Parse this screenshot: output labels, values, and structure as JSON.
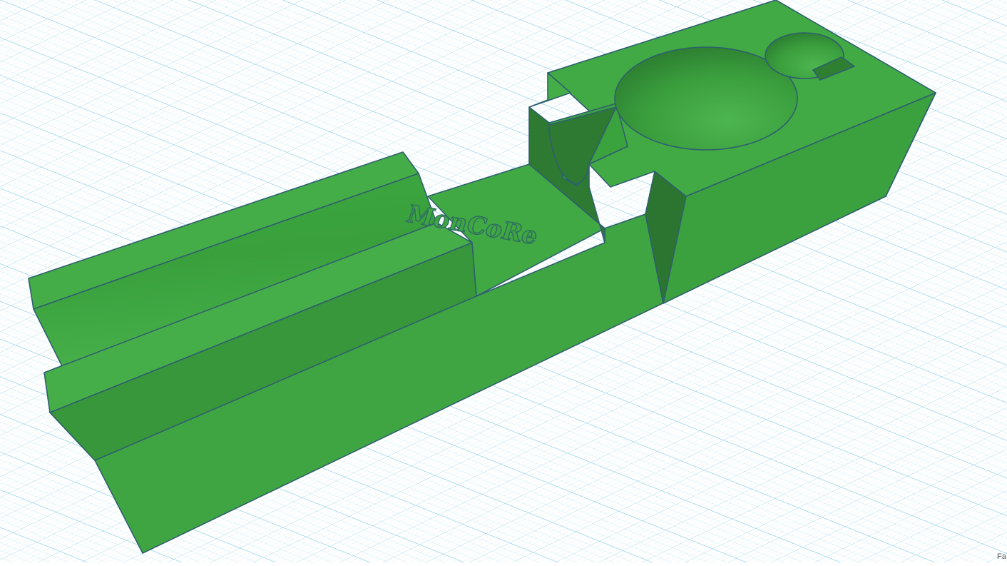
{
  "scene": {
    "model_label": "MonCoRe",
    "corner_label": "Fa",
    "colors": {
      "background": "#ffffff",
      "grid_minor": "#bfe4f2",
      "grid_major": "#7dc6e3",
      "model_top": "#41a844",
      "model_side": "#38973b",
      "model_dark": "#2a6e2e",
      "model_edge": "#2f5f6f",
      "text": "#2d6d60"
    }
  }
}
